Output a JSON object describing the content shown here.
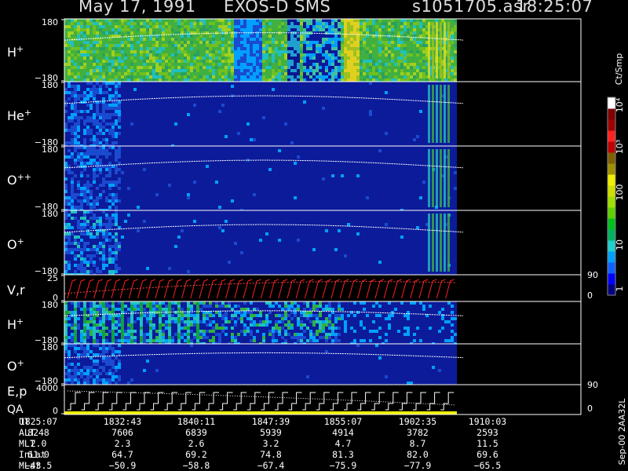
{
  "header": {
    "date": "May 17, 1991",
    "instrument": "EXOS-D SMS",
    "file": "s1051705.asr",
    "time": "18:25:07"
  },
  "panels": [
    {
      "label": "H",
      "sup": "+",
      "ymax": "180",
      "ymin": "−180"
    },
    {
      "label": "He",
      "sup": "+",
      "ymax": "180",
      "ymin": "−180"
    },
    {
      "label": "O",
      "sup": "++",
      "ymax": "180",
      "ymin": "−180"
    },
    {
      "label": "O",
      "sup": "+",
      "ymax": "180",
      "ymin": "−180"
    },
    {
      "label": "V,r",
      "sup": "",
      "ymax": "25",
      "ymin": "0",
      "rtop": "90",
      "rbot": "0"
    },
    {
      "label": "H",
      "sup": "+",
      "ymax": "180",
      "ymin": "−180"
    },
    {
      "label": "O",
      "sup": "+",
      "ymax": "180",
      "ymin": "−180"
    },
    {
      "label": "E,p",
      "label2": "QA",
      "sup": "",
      "ymax": "4000",
      "ymin": "0",
      "rtop": "90",
      "rbot": "0"
    }
  ],
  "colorbar": {
    "unit": "Ct/Smp",
    "ticks": [
      "1",
      "10",
      "100",
      "10³",
      "10⁴"
    ],
    "colors": [
      "#000080",
      "#0000ff",
      "#1060ff",
      "#00a0ff",
      "#20d0d0",
      "#00b060",
      "#00c020",
      "#60d000",
      "#a0e000",
      "#d0e000",
      "#f0f000",
      "#a09000",
      "#806000",
      "#c00000",
      "#ff2020",
      "#a00000",
      "#800000",
      "#ffffff"
    ]
  },
  "footer_note": "Sep-00  2AA32L",
  "table": {
    "rows": [
      {
        "label": "UT",
        "values": [
          "1825:07",
          "1832:43",
          "1840:11",
          "1847:39",
          "1855:07",
          "1902:35",
          "1910:03"
        ]
      },
      {
        "label": "ALT",
        "values": [
          "8248",
          "7606",
          "6839",
          "5939",
          "4914",
          "3782",
          "2593"
        ]
      },
      {
        "label": "MLT",
        "values": [
          "2.0",
          "2.3",
          "2.6",
          "3.2",
          "4.7",
          "8.7",
          "11.5"
        ]
      },
      {
        "label": "InLat",
        "values": [
          "61.0",
          "64.7",
          "69.2",
          "74.8",
          "81.3",
          "82.0",
          "69.6"
        ]
      },
      {
        "label": "MLat",
        "values": [
          "−43.5",
          "−50.9",
          "−58.8",
          "−67.4",
          "−75.9",
          "−77.9",
          "−65.5"
        ]
      }
    ]
  }
}
